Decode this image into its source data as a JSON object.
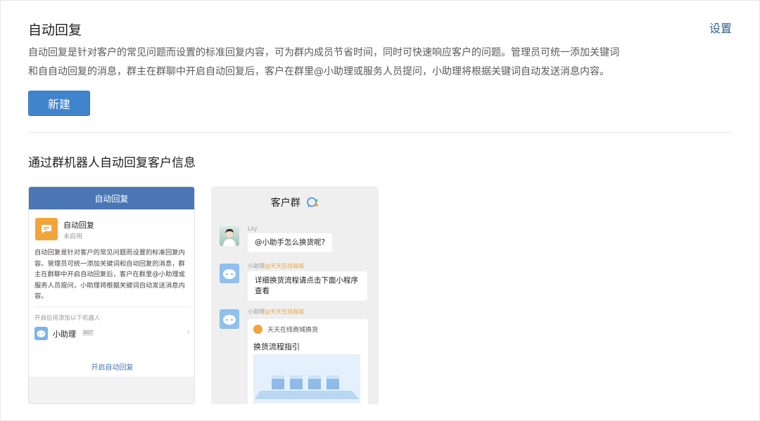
{
  "header": {
    "title": "自动回复",
    "settings_label": "设置",
    "description_lines": [
      "自动回复是针对客户的常见问题而设置的标准回复内容，可为群内成员节省时间，同时可快速响应客户的问题。管理员可统一添加关键词",
      "和自自动回复的消息，群主在群聊中开启自动回复后，客户在群里@小助理或服务人员提问，小助理将根据关键词自动发送消息内容。"
    ],
    "new_button_label": "新建"
  },
  "section": {
    "title": "通过群机器人自动回复客户信息"
  },
  "preview_left": {
    "header": "自动回复",
    "feature_name": "自动回复",
    "feature_status": "未启用",
    "feature_description": "自动回复是针对客户的常见问题而设置的标准回复内容。管理员可统一添加关键词和自动回复的消息，群主在群聊中开启自动回复后，客户在群里@小助理或服务人员提问，小助理将根据关键词自动发送消息内容。",
    "bot_note": "开启后将添加以下机器人",
    "bot_name": "小助理",
    "bot_tag": "BOT",
    "enable_button": "开启自动回复"
  },
  "preview_right": {
    "title": "客户群",
    "messages": [
      {
        "sender": "Lily",
        "sender_extra": "",
        "text": "@小助手怎么换货呢?"
      },
      {
        "sender": "小助理",
        "sender_extra": "@天天在线商城",
        "text": "详细换货流程请点击下面小程序查看"
      },
      {
        "sender": "小助理",
        "sender_extra": "@天天在线商城",
        "text": ""
      }
    ],
    "mini_program": {
      "shop_name": "天天在线商城换货",
      "title": "换货流程指引"
    }
  },
  "colors": {
    "accent": "#3f84cc",
    "link": "#2f5f95",
    "preview_header": "#4a77b4",
    "brand_orange": "#f0a43a"
  },
  "icons": [
    "feature-chat-icon",
    "bot-avatar-icon",
    "chevron-right-icon",
    "group-chat-icon",
    "shop-icon"
  ]
}
